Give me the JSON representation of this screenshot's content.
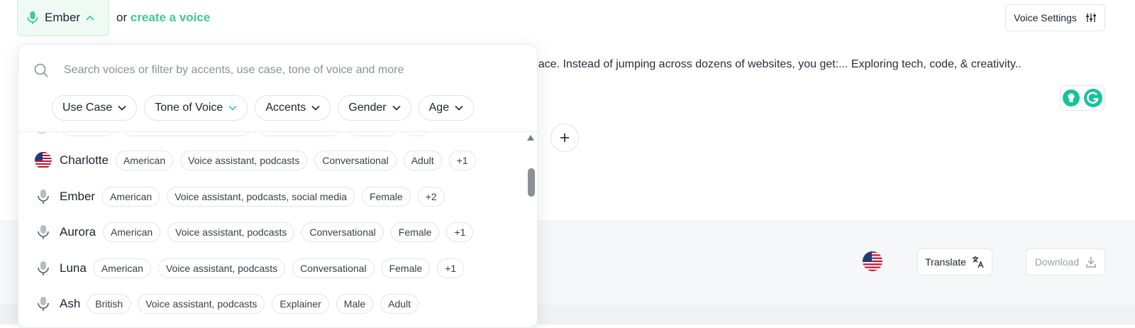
{
  "header": {
    "selected_voice": "Ember",
    "or_text": "or",
    "create_link": "create a voice",
    "voice_settings_label": "Voice Settings"
  },
  "script": {
    "text": "e place. Instead of jumping across dozens of websites, you get:... Exploring tech, code, & creativity.."
  },
  "footer": {
    "translate_label": "Translate",
    "download_label": "Download"
  },
  "dropdown": {
    "search_placeholder": "Search voices or filter by accents, use case, tone of voice and more",
    "filters": [
      {
        "label": "Use Case",
        "active": false
      },
      {
        "label": "Tone of Voice",
        "active": true
      },
      {
        "label": "Accents",
        "active": false
      },
      {
        "label": "Gender",
        "active": false
      },
      {
        "label": "Age",
        "active": false
      }
    ],
    "voices": [
      {
        "name": "Charlotte",
        "avatar": "us-flag",
        "tags": [
          "American",
          "Voice assistant, podcasts",
          "Conversational",
          "Adult",
          "+1"
        ]
      },
      {
        "name": "Ember",
        "avatar": "microphone-icon",
        "tags": [
          "American",
          "Voice assistant, podcasts, social media",
          "Female",
          "+2"
        ]
      },
      {
        "name": "Aurora",
        "avatar": "microphone-icon",
        "tags": [
          "American",
          "Voice assistant, podcasts",
          "Conversational",
          "Female",
          "+1"
        ]
      },
      {
        "name": "Luna",
        "avatar": "microphone-icon",
        "tags": [
          "American",
          "Voice assistant, podcasts",
          "Conversational",
          "Female",
          "+1"
        ]
      },
      {
        "name": "Ash",
        "avatar": "microphone-icon",
        "tags": [
          "British",
          "Voice assistant, podcasts",
          "Explainer",
          "Male",
          "Adult"
        ]
      }
    ]
  },
  "colors": {
    "accent": "#3ecb8e",
    "grammarly": "#15c39a"
  }
}
